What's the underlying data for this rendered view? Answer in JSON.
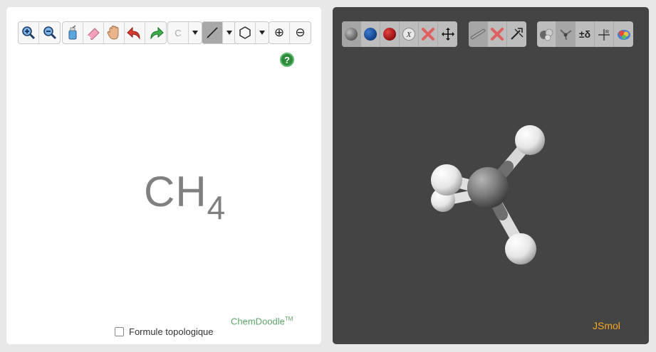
{
  "editor": {
    "toolbar": {
      "zoom_in": "zoom-in-icon",
      "zoom_out": "zoom-out-icon",
      "clear": "clear-icon",
      "erase": "eraser-icon",
      "pan": "hand-icon",
      "undo": "undo-icon",
      "redo": "redo-icon",
      "atom_label": "C",
      "bond": "single-bond-icon",
      "ring": "hexagon-icon",
      "charge_plus": "⊕",
      "charge_minus": "⊖"
    },
    "help_label": "?",
    "formula_main": "CH",
    "formula_sub": "4",
    "brand": "ChemDoodle",
    "brand_tm": "TM",
    "checkbox_label": "Formule topologique",
    "checkbox_checked": false
  },
  "viewer": {
    "toolbar": {
      "carbon": "carbon-ball-icon",
      "nitrogen": "nitrogen-ball-icon",
      "oxygen": "oxygen-ball-icon",
      "other_element": "X",
      "delete_atom": "delete-icon",
      "move": "move-icon",
      "bond": "bond-icon",
      "delete_bond": "delete-bond-icon",
      "minimize": "minimize-icon",
      "ball_style": "ball-icon",
      "wire_style": "wire-icon",
      "charge_label": "±δ",
      "dipole": "dipole-icon",
      "surface": "surface-icon"
    },
    "brand": "JSmol",
    "colors": {
      "background": "#444444",
      "brand": "#f5a623",
      "carbon": "#8a8a8a",
      "hydrogen": "#f2f2f2"
    }
  }
}
